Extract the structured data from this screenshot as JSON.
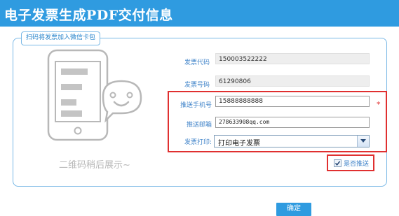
{
  "header": {
    "title": "电子发票生成PDF交付信息"
  },
  "panel": {
    "legend": "扫码将发票加入微信卡包",
    "qr_hint": "二维码稍后展示~"
  },
  "form": {
    "invoice_code_label": "发票代码",
    "invoice_code_value": "150003522222",
    "invoice_number_label": "发票号码",
    "invoice_number_value": "61290806",
    "phone_label": "推送手机号",
    "phone_value": "15888888888",
    "email_label": "推送邮箱",
    "email_value": "278633908qq.com",
    "print_label": "发票打印:",
    "print_selected": "打印电子发票",
    "required_mark": "*",
    "push_checkbox_label": "是否推送",
    "push_checked": true
  },
  "actions": {
    "confirm_label": "确定"
  },
  "colors": {
    "accent": "#2f9be0",
    "label_blue": "#3f83c9",
    "highlight_red": "#e03030",
    "panel_border": "#79b8e6"
  },
  "icons": [
    "phone-icon",
    "chat-bubble-icon",
    "chevron-down-icon",
    "checkmark-icon"
  ]
}
